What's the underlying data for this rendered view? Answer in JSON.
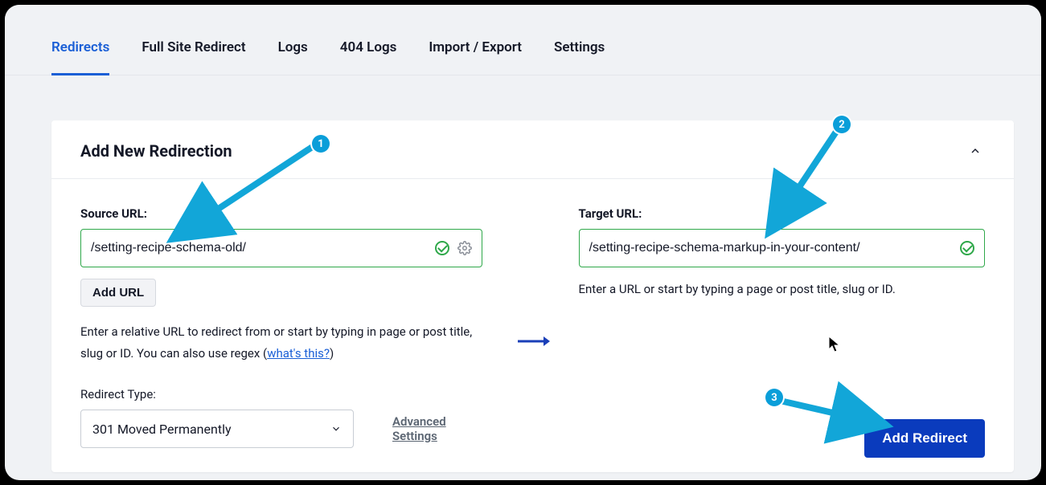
{
  "tabs": {
    "redirects": "Redirects",
    "full_site": "Full Site Redirect",
    "logs": "Logs",
    "err_logs": "404 Logs",
    "import_export": "Import / Export",
    "settings": "Settings"
  },
  "card": {
    "title": "Add New Redirection"
  },
  "source": {
    "label": "Source URL:",
    "value": "/setting-recipe-schema-old/",
    "add_url_label": "Add URL",
    "help_prefix": "Enter a relative URL to redirect from or start by typing in page or post title, slug or ID. You can also use regex (",
    "help_link": "what's this?",
    "help_suffix": ")"
  },
  "target": {
    "label": "Target URL:",
    "value": "/setting-recipe-schema-markup-in-your-content/",
    "help": "Enter a URL or start by typing a page or post title, slug or ID."
  },
  "redirect_type": {
    "label": "Redirect Type:",
    "value": "301 Moved Permanently",
    "advanced": "Advanced Settings"
  },
  "submit": {
    "label": "Add Redirect"
  },
  "annotations": {
    "a1": "1",
    "a2": "2",
    "a3": "3"
  }
}
